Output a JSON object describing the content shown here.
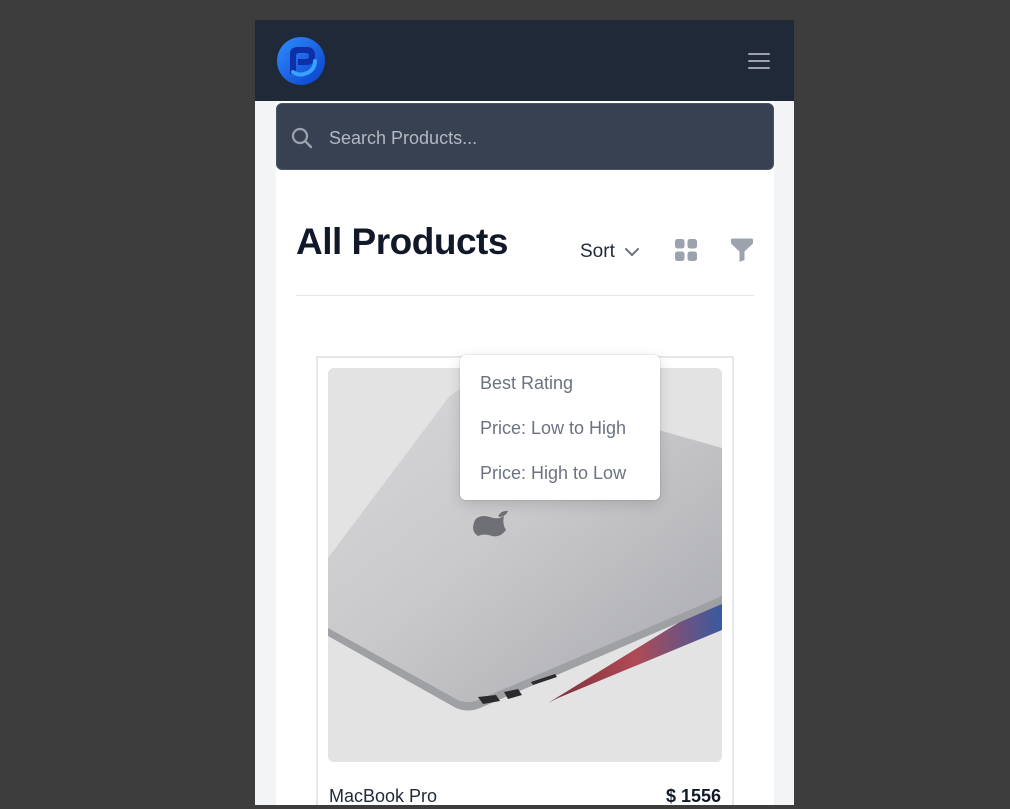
{
  "header": {
    "logo_icon": "app-logo-icon",
    "menu_icon": "hamburger-menu-icon"
  },
  "search": {
    "placeholder": "Search Products...",
    "value": ""
  },
  "page": {
    "title": "All Products"
  },
  "toolbar": {
    "sort_label": "Sort",
    "sort_options": [
      "Best Rating",
      "Price: Low to High",
      "Price: High to Low"
    ],
    "grid_icon": "grid-view-icon",
    "filter_icon": "filter-icon"
  },
  "products": [
    {
      "name": "MacBook Pro",
      "price": "$ 1556"
    }
  ],
  "colors": {
    "navbar": "#1f2937",
    "search_bg": "#374151",
    "logo_blue": "#1d6ff2",
    "outer_bg": "#3d3d3d"
  }
}
